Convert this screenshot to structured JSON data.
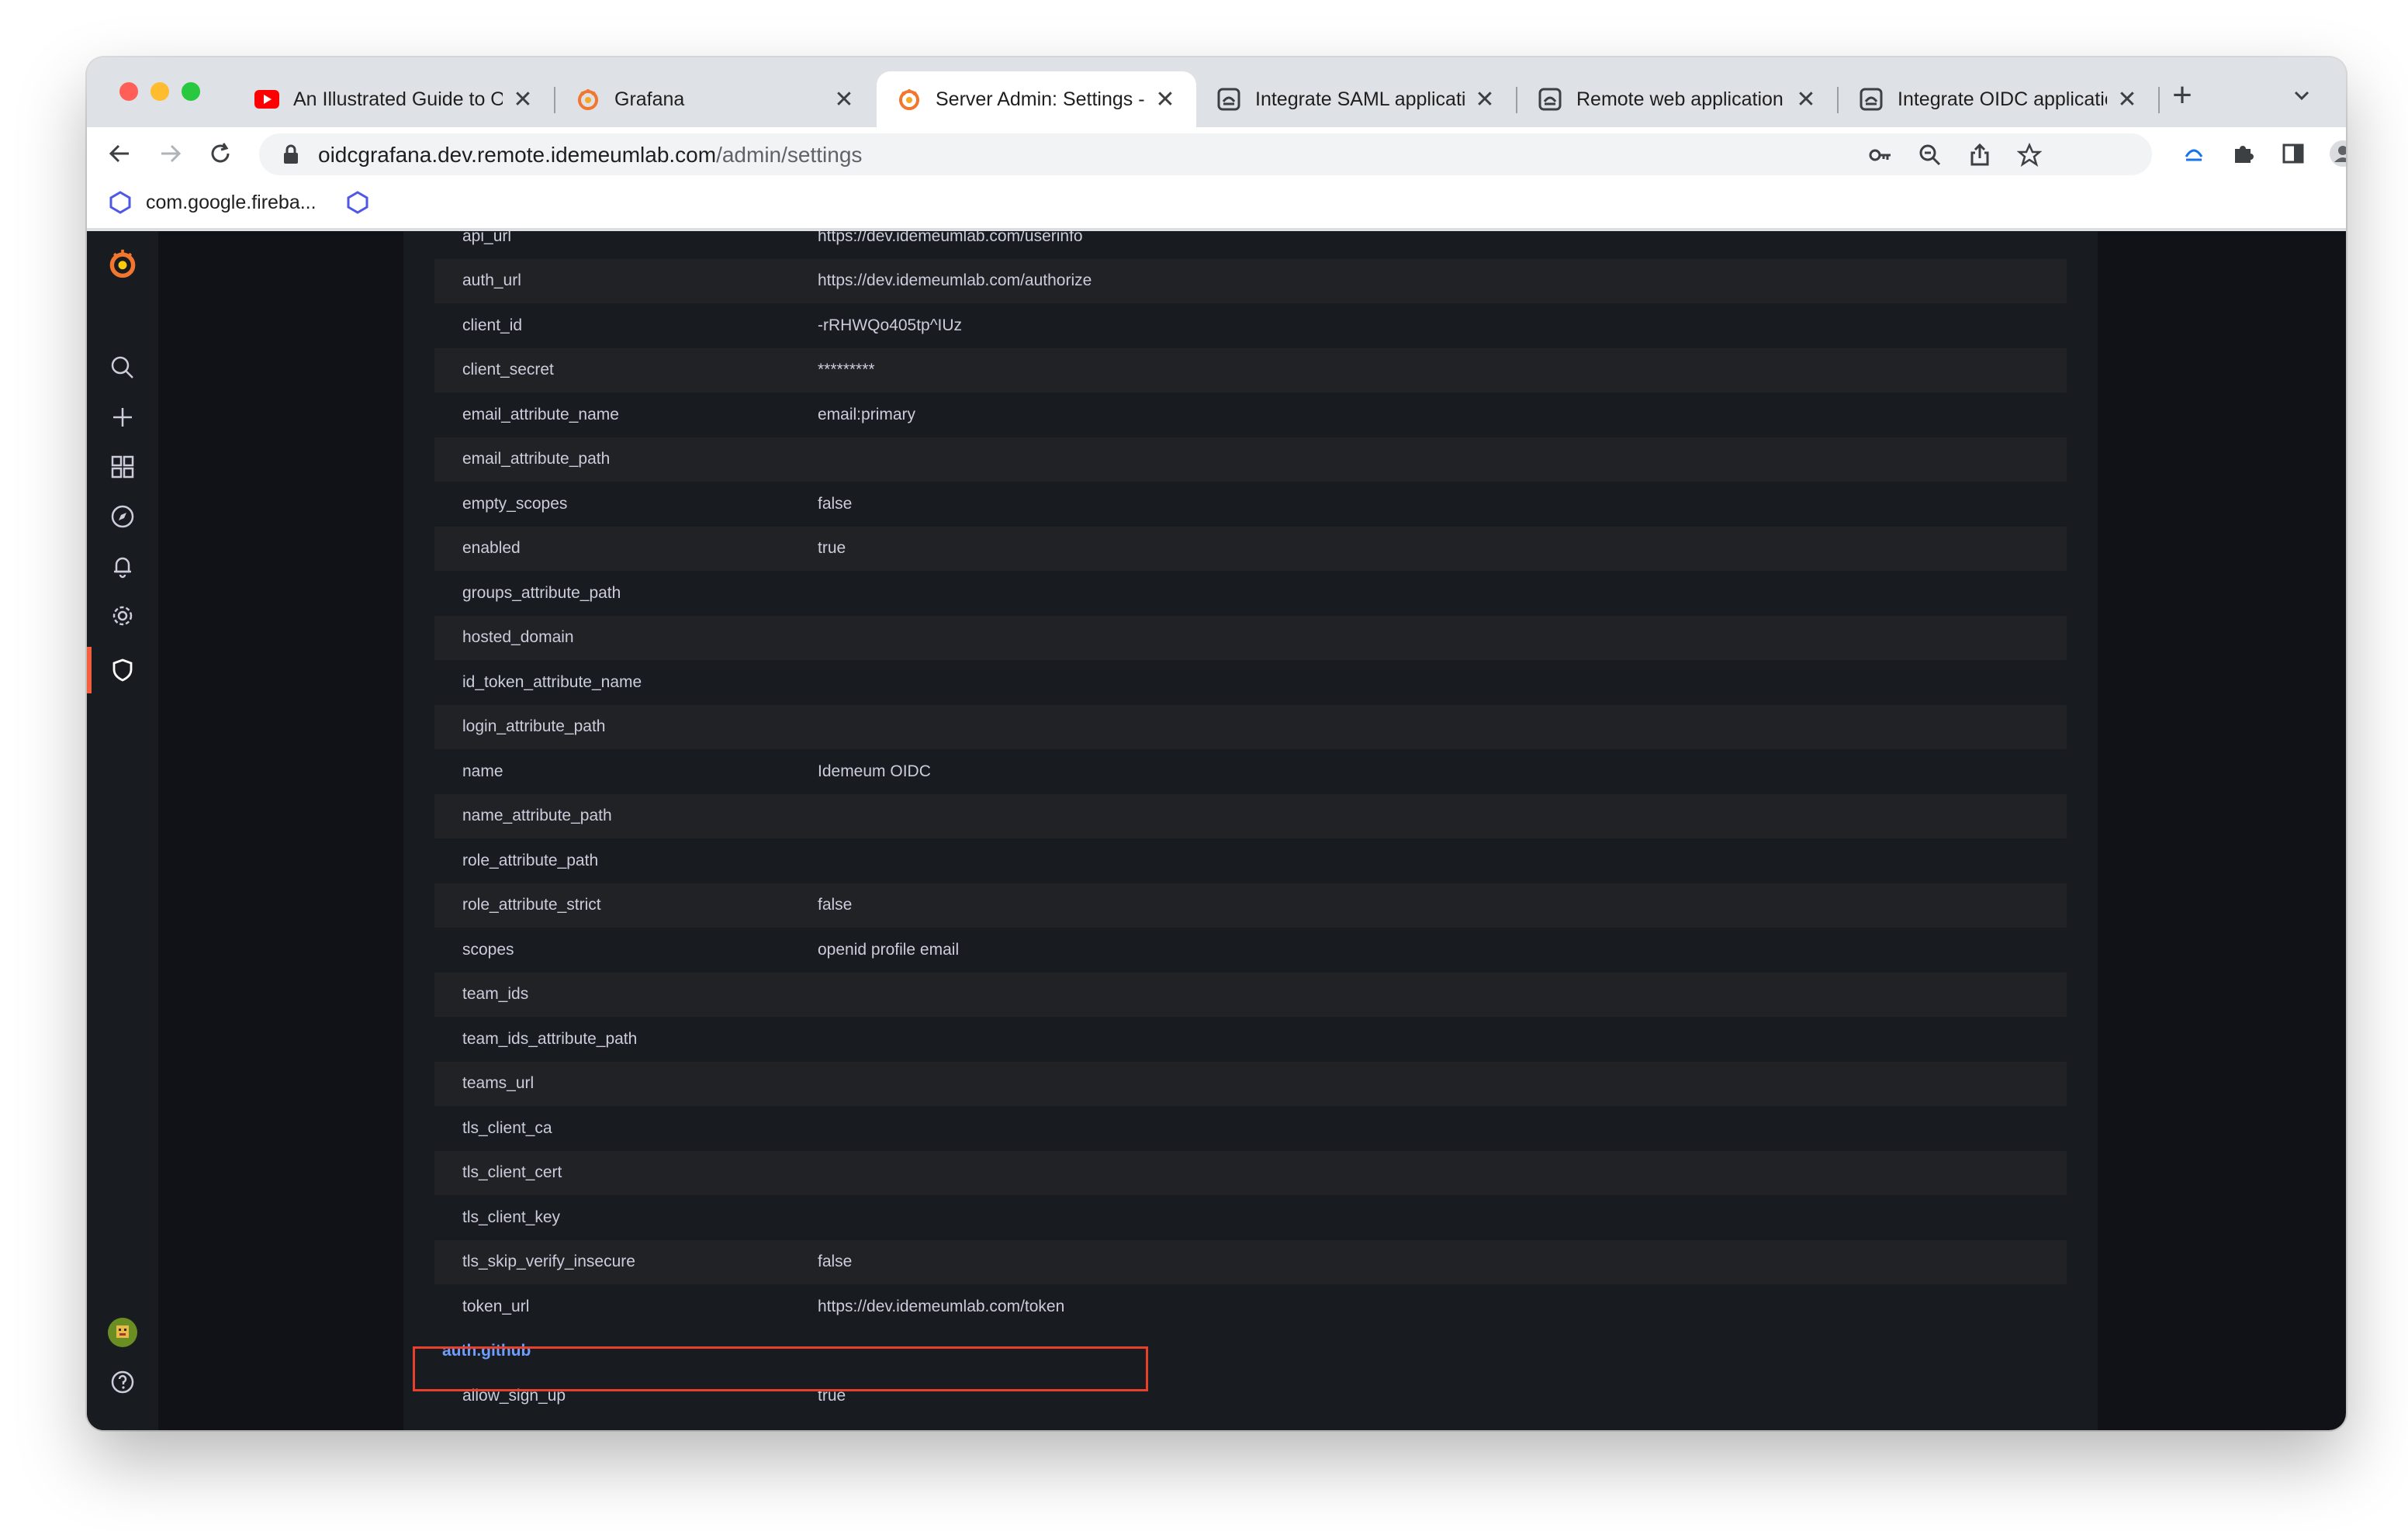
{
  "browser": {
    "tabs": [
      {
        "title": "An Illustrated Guide to O",
        "icon": "youtube-icon"
      },
      {
        "title": "Grafana",
        "icon": "grafana-icon"
      },
      {
        "title": "Server Admin: Settings - ",
        "icon": "grafana-icon",
        "active": true
      },
      {
        "title": "Integrate SAML applicati",
        "icon": "idemeum-icon"
      },
      {
        "title": "Remote web application",
        "icon": "idemeum-icon"
      },
      {
        "title": "Integrate OIDC applicatio",
        "icon": "idemeum-icon"
      }
    ],
    "close_glyph": "✕",
    "new_tab_glyph": "+",
    "url_host": "oidcgrafana.dev.remote.idemeumlab.com",
    "url_path": "/admin/settings",
    "bookmarks": [
      {
        "label": "com.google.fireba...",
        "icon": "firebase-hex-icon"
      },
      {
        "label": "",
        "icon": "firebase-hex-icon"
      }
    ]
  },
  "grafana": {
    "settings_rows": [
      {
        "key": "api_url",
        "value": "https://dev.idemeumlab.com/userinfo"
      },
      {
        "key": "auth_url",
        "value": "https://dev.idemeumlab.com/authorize"
      },
      {
        "key": "client_id",
        "value": "-rRHWQo405tp^IUz"
      },
      {
        "key": "client_secret",
        "value": "*********"
      },
      {
        "key": "email_attribute_name",
        "value": "email:primary"
      },
      {
        "key": "email_attribute_path",
        "value": ""
      },
      {
        "key": "empty_scopes",
        "value": "false"
      },
      {
        "key": "enabled",
        "value": "true"
      },
      {
        "key": "groups_attribute_path",
        "value": ""
      },
      {
        "key": "hosted_domain",
        "value": ""
      },
      {
        "key": "id_token_attribute_name",
        "value": ""
      },
      {
        "key": "login_attribute_path",
        "value": ""
      },
      {
        "key": "name",
        "value": "Idemeum OIDC"
      },
      {
        "key": "name_attribute_path",
        "value": ""
      },
      {
        "key": "role_attribute_path",
        "value": ""
      },
      {
        "key": "role_attribute_strict",
        "value": "false"
      },
      {
        "key": "scopes",
        "value": "openid profile email"
      },
      {
        "key": "team_ids",
        "value": ""
      },
      {
        "key": "team_ids_attribute_path",
        "value": ""
      },
      {
        "key": "teams_url",
        "value": ""
      },
      {
        "key": "tls_client_ca",
        "value": ""
      },
      {
        "key": "tls_client_cert",
        "value": ""
      },
      {
        "key": "tls_client_key",
        "value": ""
      },
      {
        "key": "tls_skip_verify_insecure",
        "value": "false"
      },
      {
        "key": "token_url",
        "value": "https://dev.idemeumlab.com/token"
      }
    ],
    "section_title": "auth.github",
    "section_rows": [
      {
        "key": "allow_sign_up",
        "value": "true"
      }
    ],
    "highlight_color": "#e8402b",
    "accent_color": "#f55f3e"
  }
}
